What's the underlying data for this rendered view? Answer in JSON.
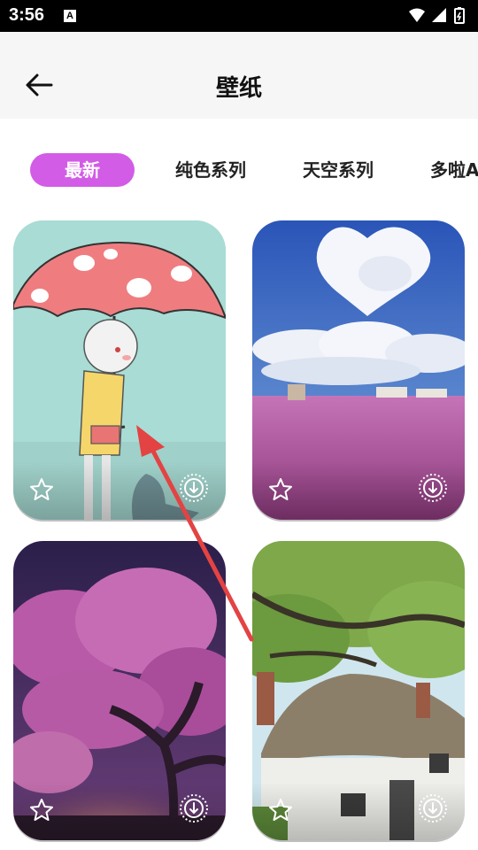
{
  "status_bar": {
    "time": "3:56",
    "notification_badge": "A"
  },
  "header": {
    "title": "壁纸",
    "back_icon": "arrow-left-icon"
  },
  "tabs": [
    {
      "label": "最新",
      "active": true
    },
    {
      "label": "纯色系列",
      "active": false
    },
    {
      "label": "天空系列",
      "active": false
    },
    {
      "label": "多啦A",
      "active": false
    }
  ],
  "colors": {
    "accent": "#d25ce6",
    "header_bg": "#f6f6f6"
  },
  "wallpapers": [
    {
      "subject": "girl with red mushroom umbrella",
      "star_icon": "star-outline-icon",
      "download_icon": "download-circle-icon"
    },
    {
      "subject": "clouds over pink grass field",
      "star_icon": "star-outline-icon",
      "download_icon": "download-circle-icon"
    },
    {
      "subject": "purple blossom tree at night",
      "star_icon": "star-outline-icon",
      "download_icon": "download-circle-icon"
    },
    {
      "subject": "thatched cottage under tree",
      "star_icon": "star-outline-icon",
      "download_icon": "download-circle-icon"
    }
  ]
}
